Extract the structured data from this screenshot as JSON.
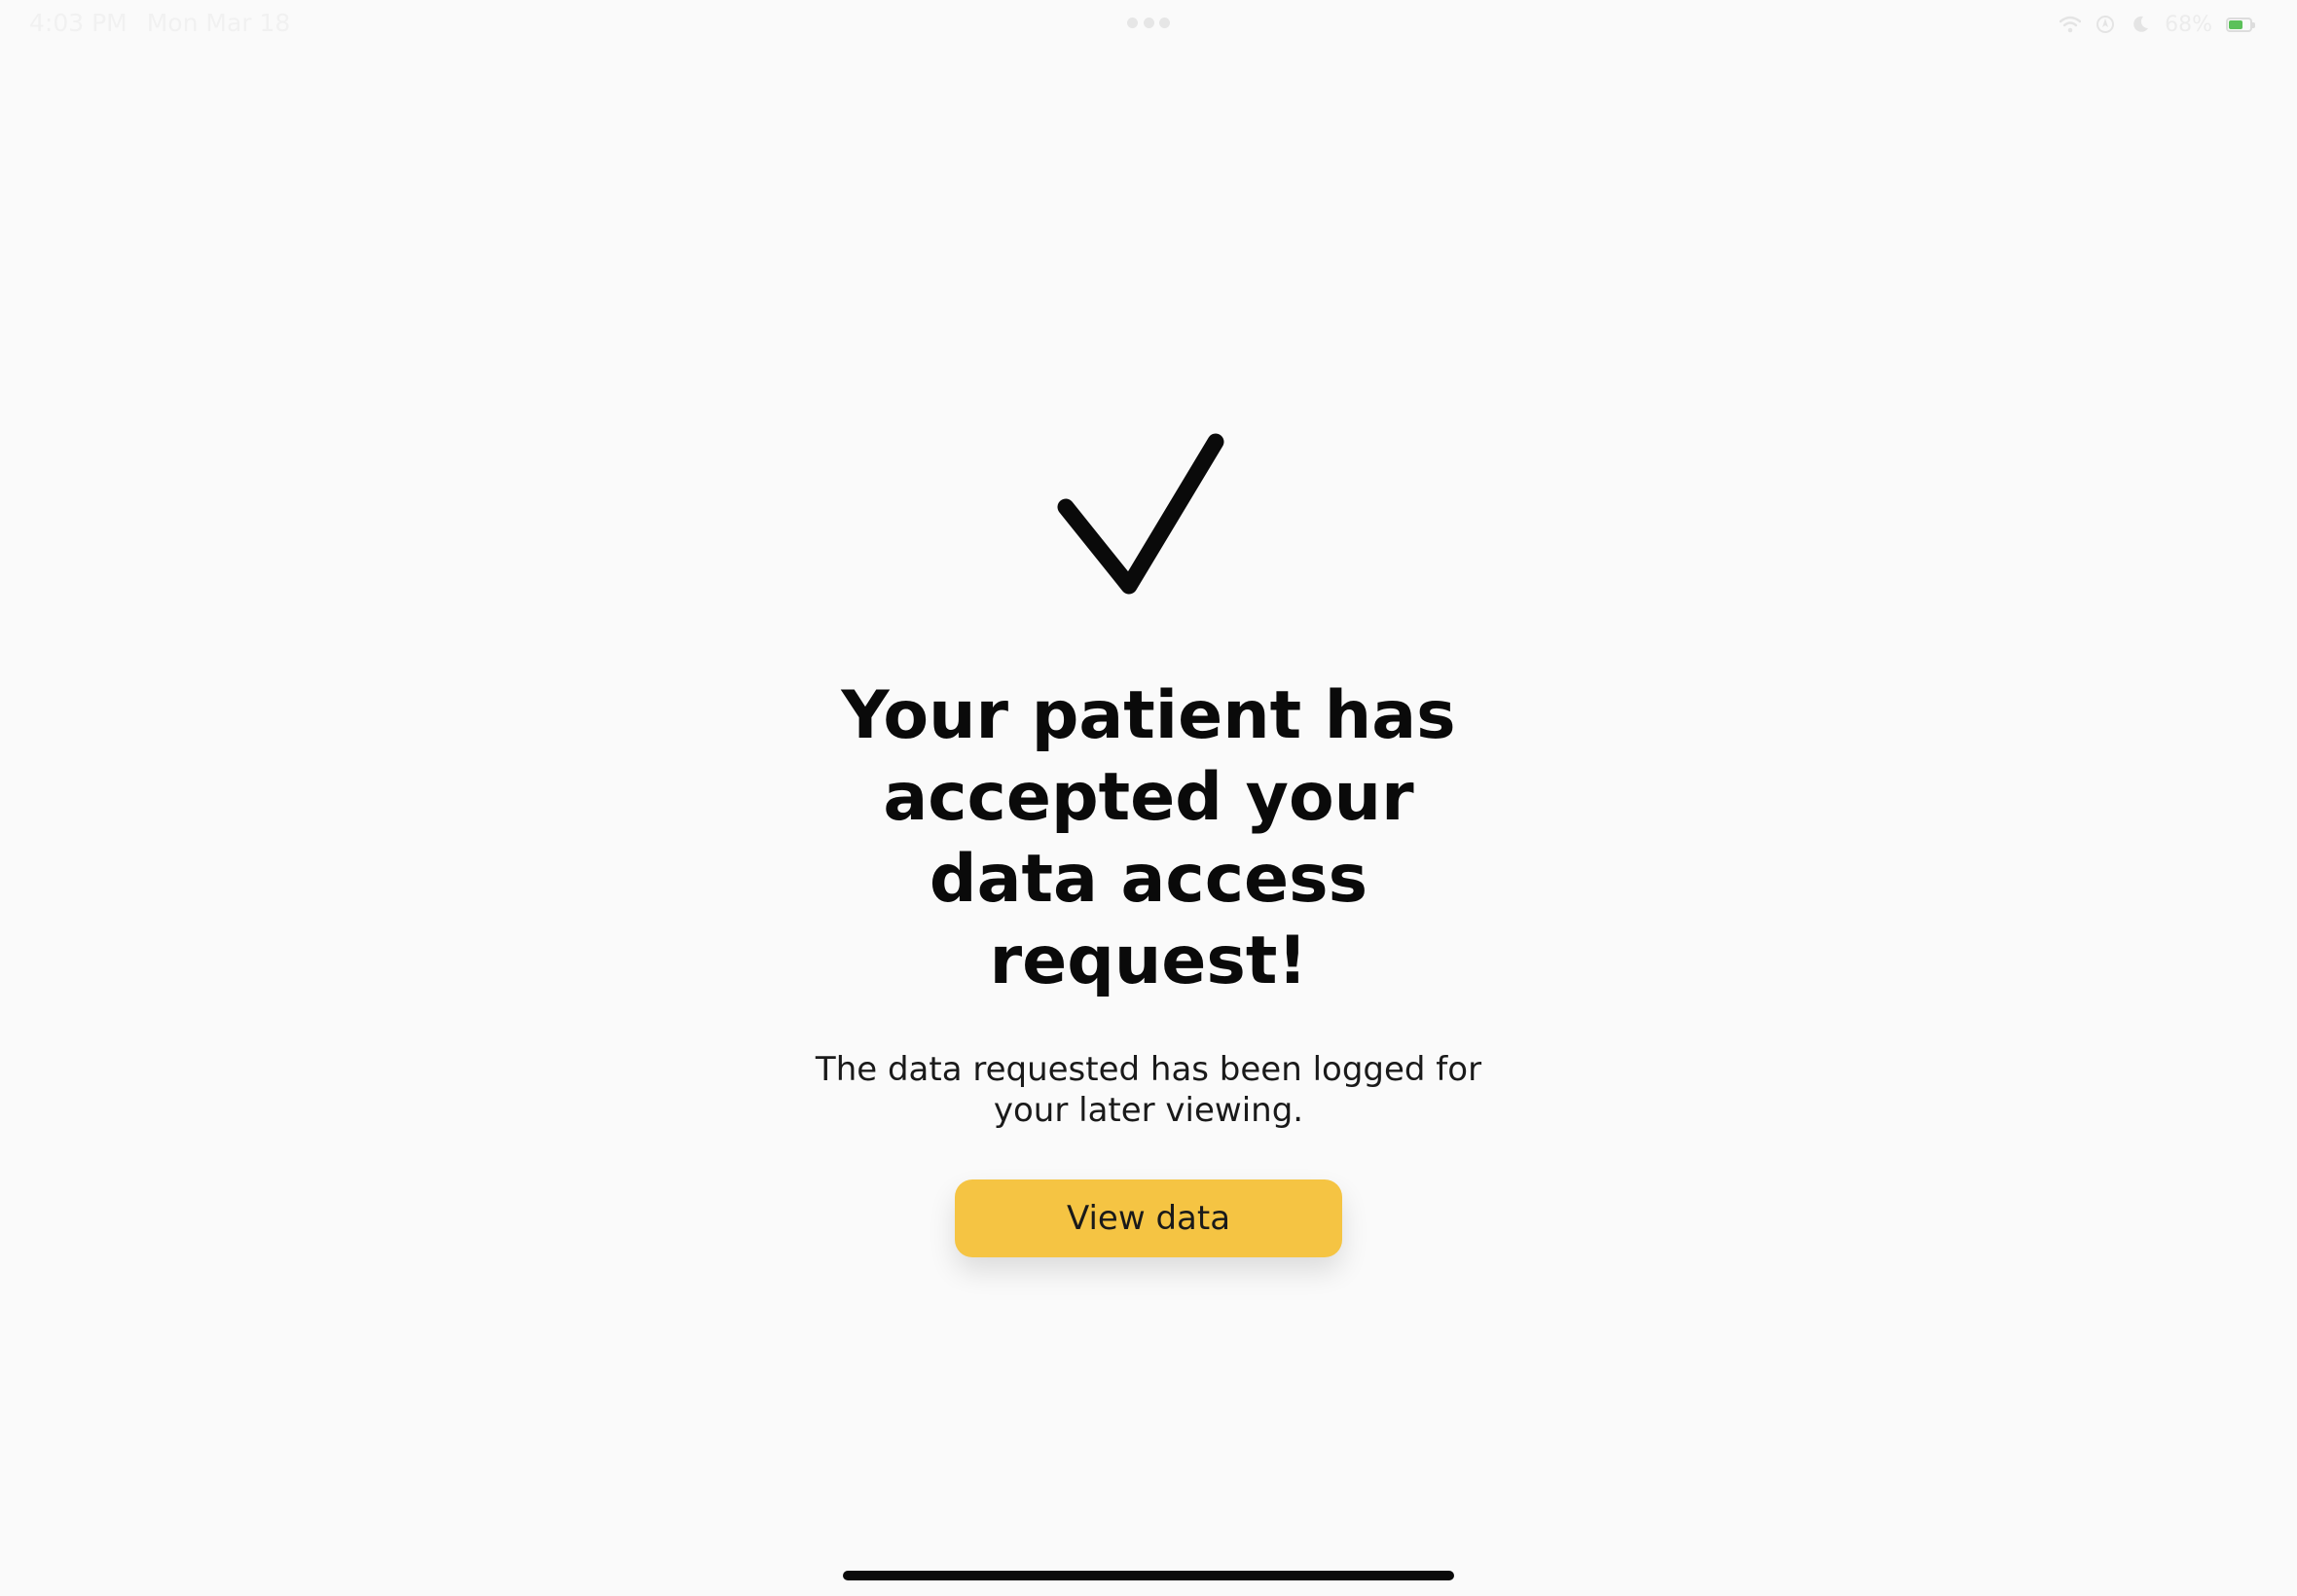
{
  "status_bar": {
    "time": "4:03 PM",
    "date": "Mon Mar 18",
    "battery_percent": "68%",
    "battery_level": 0.68,
    "battery_color": "#5cc15a",
    "icons": [
      "wifi-icon",
      "location-icon",
      "moon-icon",
      "battery-icon"
    ]
  },
  "main": {
    "status_icon": "checkmark-icon",
    "headline": "Your patient has accepted your data access request!",
    "subtext": "The data requested has been logged for your later viewing.",
    "button_label": "View data",
    "accent_color": "#f5c443"
  }
}
